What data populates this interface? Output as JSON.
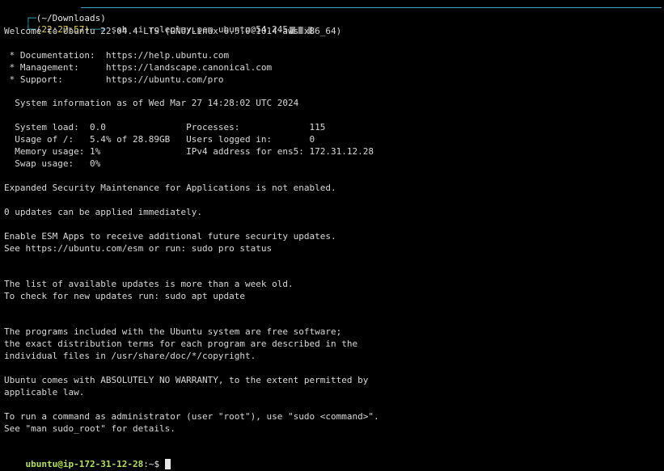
{
  "header": {
    "dir": "(~/Downloads)",
    "time": "(22:27:57)",
    "command": "ssh -i roleplay.pem ubuntu@54.245"
  },
  "output": [
    "Welcome to Ubuntu 22.04.4 LTS (GNU/Linux 6.5.0-1014-aws x86_64)",
    " * Documentation:  https://help.ubuntu.com",
    " * Management:     https://landscape.canonical.com",
    " * Support:        https://ubuntu.com/pro",
    "  System information as of Wed Mar 27 14:28:02 UTC 2024",
    "  System load:  0.0               Processes:             115",
    "  Usage of /:   5.4% of 28.89GB   Users logged in:       0",
    "  Memory usage: 1%                IPv4 address for ens5: 172.31.12.28",
    "  Swap usage:   0%",
    "Expanded Security Maintenance for Applications is not enabled.",
    "0 updates can be applied immediately.",
    "Enable ESM Apps to receive additional future security updates.",
    "See https://ubuntu.com/esm or run: sudo pro status",
    "The list of available updates is more than a week old.",
    "To check for new updates run: sudo apt update",
    "The programs included with the Ubuntu system are free software;",
    "the exact distribution terms for each program are described in the",
    "individual files in /usr/share/doc/*/copyright.",
    "Ubuntu comes with ABSOLUTELY NO WARRANTY, to the extent permitted by",
    "applicable law.",
    "To run a command as administrator (user \"root\"), use \"sudo <command>\".",
    "See \"man sudo_root\" for details."
  ],
  "prompt": {
    "user_host": "ubuntu@ip-172-31-12-28",
    "tail": ":~$ "
  },
  "colors": {
    "background": "#000000",
    "text": "#d9d9d9",
    "frame": "#3aa7c2",
    "time": "#e5d84c",
    "prompt_user": "#b7e24f"
  }
}
